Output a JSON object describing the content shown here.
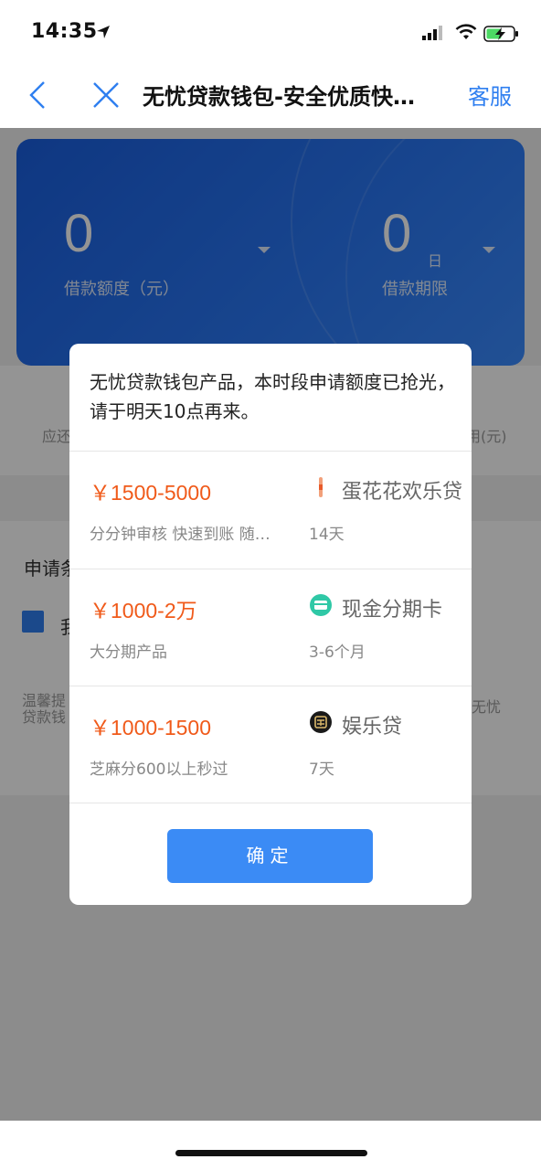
{
  "status_bar": {
    "time": "14:35"
  },
  "nav": {
    "title": "无忧贷款钱包-安全优质快…",
    "service": "客服"
  },
  "background": {
    "amount_value": "0",
    "amount_label": "借款额度（元）",
    "term_value": "0",
    "term_unit": "日",
    "term_label": "借款期限",
    "info_left": "应还",
    "info_right": "用(元)",
    "apply_label": "申请条",
    "agree_text": "我",
    "tip_left": "温馨提 贷款钱",
    "tip_right": "无忧"
  },
  "modal": {
    "message": "无忧贷款钱包产品，本时段申请额度已抢光，请于明天10点再来。",
    "products": [
      {
        "range": "￥1500-5000",
        "desc": "分分钟审核 快速到账 随…",
        "name": "蛋花花欢乐贷",
        "term": "14天",
        "icon": "egg-icon"
      },
      {
        "range": "￥1000-2万",
        "desc": "大分期产品",
        "name": "现金分期卡",
        "term": "3-6个月",
        "icon": "card-icon"
      },
      {
        "range": "￥1000-1500",
        "desc": "芝麻分600以上秒过",
        "name": "娱乐贷",
        "term": "7天",
        "icon": "dai-icon"
      }
    ],
    "confirm": "确定"
  },
  "colors": {
    "accent": "#2f7ff0",
    "price": "#f05a1a",
    "button": "#3b8bf5"
  }
}
